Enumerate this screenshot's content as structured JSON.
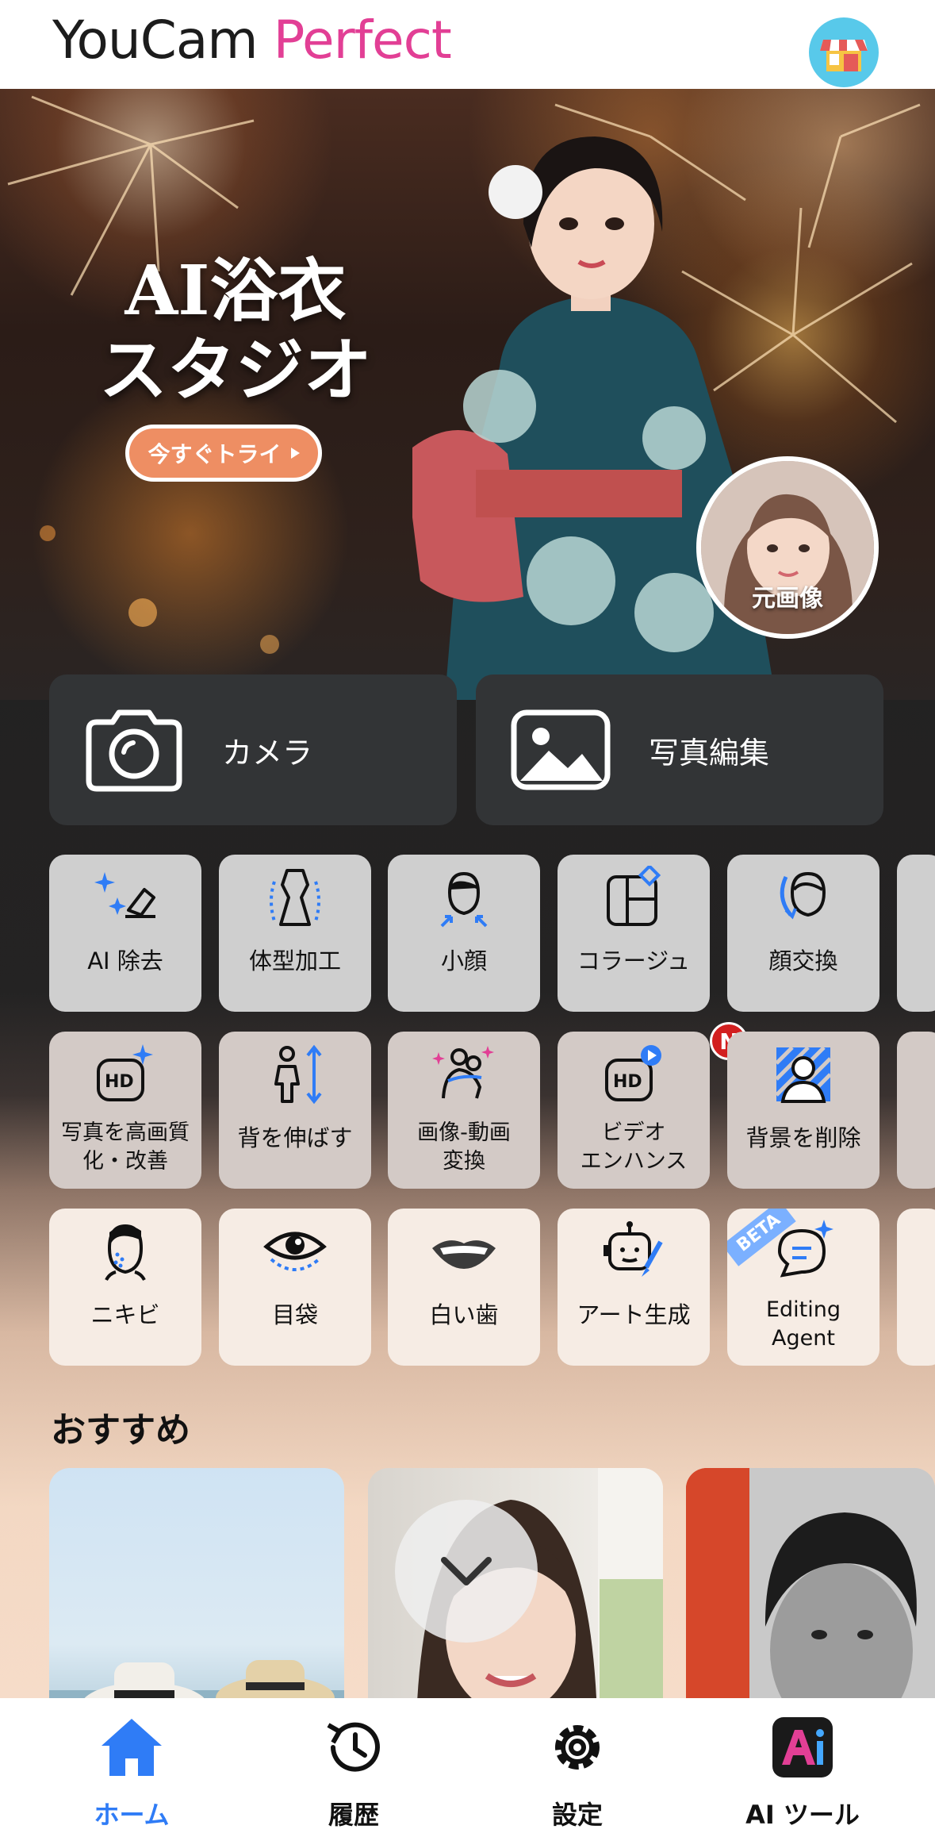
{
  "header": {
    "logo_part1": "YouCam ",
    "logo_part2": "Perfect"
  },
  "hero": {
    "title_line1": "AI浴衣",
    "title_line2": "スタジオ",
    "cta": "今すぐトライ",
    "original_label": "元画像"
  },
  "main_actions": {
    "camera": "カメラ",
    "photo_edit": "写真編集"
  },
  "tools": {
    "row1": [
      "AI 除去",
      "体型加工",
      "小顔",
      "コラージュ",
      "顔交換"
    ],
    "row2": [
      {
        "line1": "写真を高画質",
        "line2": "化・改善"
      },
      {
        "line1": "背を伸ばす",
        "line2": ""
      },
      {
        "line1": "画像-動画",
        "line2": "変換"
      },
      {
        "line1": "ビデオ",
        "line2": "エンハンス"
      },
      {
        "line1": "背景を削除",
        "line2": ""
      }
    ],
    "row3": [
      {
        "line1": "ニキビ",
        "line2": ""
      },
      {
        "line1": "目袋",
        "line2": ""
      },
      {
        "line1": "白い歯",
        "line2": ""
      },
      {
        "line1": "アート生成",
        "line2": ""
      },
      {
        "line1": "Editing",
        "line2": "Agent"
      }
    ],
    "new_badge": "N",
    "beta_badge": "BETA"
  },
  "recommend": {
    "title": "おすすめ"
  },
  "tabbar": {
    "home": "ホーム",
    "history": "履歴",
    "settings": "設定",
    "ai_tools": "AI ツール"
  },
  "colors": {
    "accent": "#2f7cf6",
    "brand_pink": "#e23f95",
    "cta_orange": "#ee8e63"
  }
}
